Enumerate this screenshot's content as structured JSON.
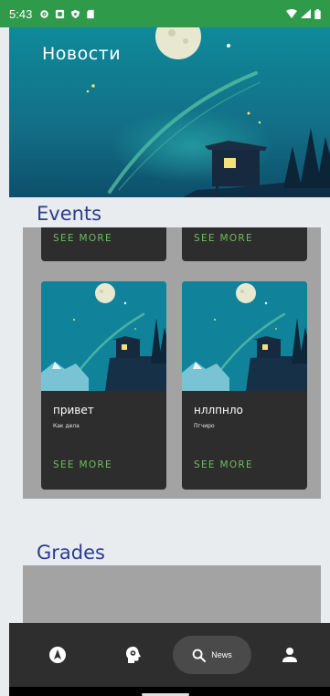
{
  "status_bar": {
    "time": "5:43"
  },
  "hero": {
    "title": "Новости"
  },
  "events": {
    "title": "Events",
    "top_cards": [
      {
        "see_more": "SEE MORE"
      },
      {
        "see_more": "SEE MORE"
      }
    ],
    "cards": [
      {
        "title": "привет",
        "subtitle": "Как дела",
        "see_more": "SEE MORE"
      },
      {
        "title": "нллпнло",
        "subtitle": "Пгчиро",
        "see_more": "SEE MORE"
      }
    ]
  },
  "grades": {
    "title": "Grades"
  },
  "bottom_nav": {
    "items": [
      {
        "icon": "navigation-icon"
      },
      {
        "icon": "head-gear-icon"
      },
      {
        "icon": "search-icon",
        "label": "News",
        "active": true
      },
      {
        "icon": "person-icon"
      }
    ]
  },
  "colors": {
    "status_bar": "#2f9a4a",
    "accent_text": "#2b3d8f",
    "see_more": "#6bbf59",
    "card_bg": "#2d2d2d",
    "nav_bg": "#2e2e2e"
  }
}
